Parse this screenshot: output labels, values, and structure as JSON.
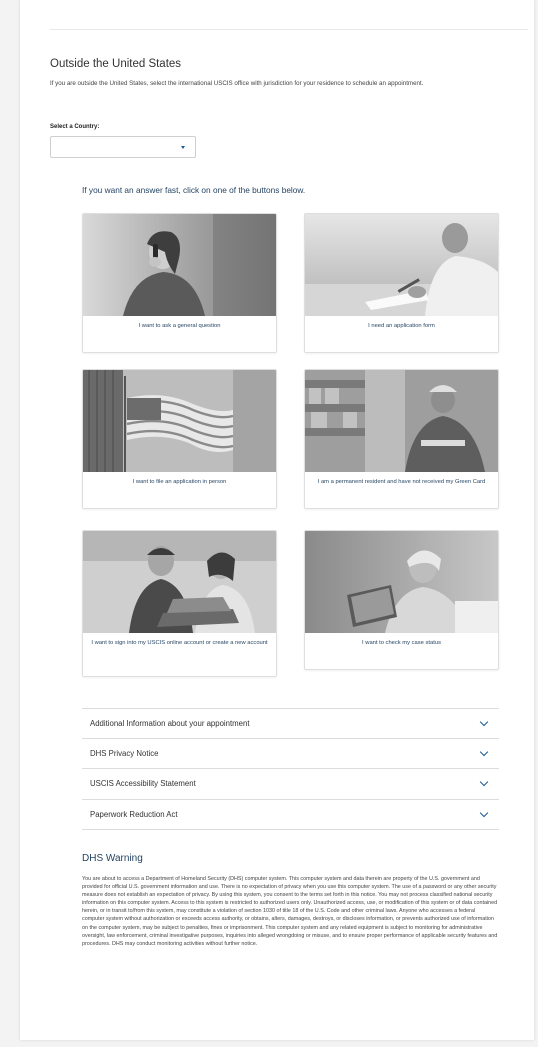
{
  "outside": {
    "title": "Outside the United States",
    "description": "If you are outside the United States, select the international USCIS office with jurisdiction for your residence to schedule an appointment.",
    "select_label": "Select a Country:",
    "select_value": ""
  },
  "fast": {
    "heading": "If you want an answer fast, click on one of the buttons below."
  },
  "cards": [
    {
      "label": "I want to ask a general question",
      "photo": "woman-on-phone-photo"
    },
    {
      "label": "I need an application form",
      "photo": "man-writing-photo"
    },
    {
      "label": "I want to file an application in person",
      "photo": "american-flag-photo"
    },
    {
      "label": "I am a permanent resident and have not received my Green Card",
      "photo": "warehouse-worker-photo"
    },
    {
      "label": "I want to sign into my USCIS online account or create a new account",
      "photo": "people-at-laptop-photo"
    },
    {
      "label": "I want to check my case status",
      "photo": "woman-with-tablet-photo"
    }
  ],
  "accordion": [
    {
      "title": "Additional Information about your appointment",
      "icon": "chevron-down-icon"
    },
    {
      "title": "DHS Privacy Notice",
      "icon": "chevron-down-icon"
    },
    {
      "title": "USCIS Accessibility Statement",
      "icon": "chevron-down-icon"
    },
    {
      "title": "Paperwork Reduction Act",
      "icon": "chevron-down-icon"
    }
  ],
  "dhs_warning": {
    "title": "DHS Warning",
    "text": "You are about to access a Department of Homeland Security (DHS) computer system. This computer system and data therein are property of the U.S. government and provided for official U.S. government information and use. There is no expectation of privacy when you use this computer system. The use of a password or any other security measure does not establish an expectation of privacy. By using this system, you consent to the terms set forth in this notice. You may not process classified national security information on this computer system. Access to this system is restricted to authorized users only. Unauthorized access, use, or modification of this system or of data contained herein, or in transit to/from this system, may constitute a violation of section 1030 of title 18 of the U.S. Code and other criminal laws. Anyone who accesses a federal computer system without authorization or exceeds access authority, or obtains, alters, damages, destroys, or discloses information, or prevents authorized use of information on the computer system, may be subject to penalties, fines or imprisonment. This computer system and any related equipment is subject to monitoring for administrative oversight, law enforcement, criminal investigative purposes, inquiries into alleged wrongdoing or misuse, and to ensure proper performance of applicable security features and procedures. DHS may conduct monitoring activities without further notice."
  },
  "colors": {
    "link_blue": "#1a5a96",
    "heading_navy": "#1f3f5f"
  }
}
